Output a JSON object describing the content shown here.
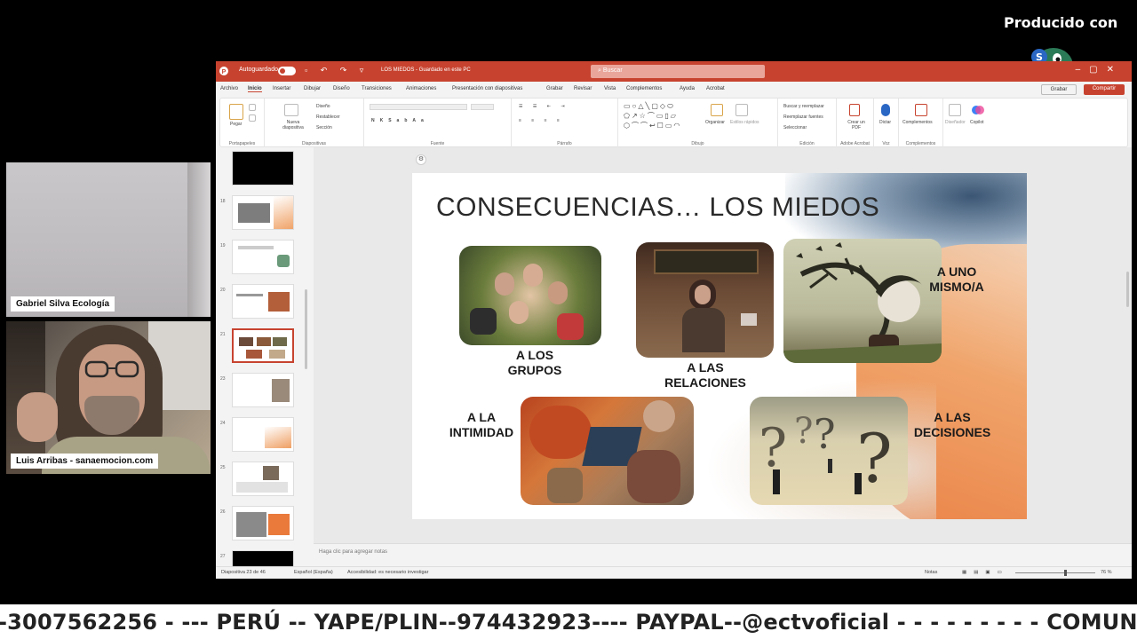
{
  "overlay": {
    "brand_text": "Producido con",
    "ticker": "-3007562256 - --- PERÚ -- YAPE/PLIN--974432923---- PAYPAL--@ectvoficial - - - - - - - - - COMUNÍCATE"
  },
  "participants": [
    {
      "name": "Gabriel Silva Ecología"
    },
    {
      "name": "Luis Arribas - sanaemocion.com"
    }
  ],
  "powerpoint": {
    "titlebar": {
      "autosave_label": "Autoguardado",
      "file_name": "LOS MIEDOS - Guardado en este PC",
      "search_placeholder": "Buscar"
    },
    "tabs": [
      "Archivo",
      "Inicio",
      "Insertar",
      "Dibujar",
      "Diseño",
      "Transiciones",
      "Animaciones",
      "Presentación con diapositivas",
      "Grabar",
      "Revisar",
      "Vista",
      "Complementos",
      "Ayuda",
      "Acrobat"
    ],
    "active_tab": "Inicio",
    "share_label": "Compartir",
    "record_label": "Grabar",
    "ribbon_groups": [
      {
        "label": "Portapapeles",
        "items": [
          "Pegar"
        ]
      },
      {
        "label": "Diapositivas",
        "items": [
          "Nueva diapositiva",
          "Diseño",
          "Restablecer",
          "Sección"
        ]
      },
      {
        "label": "Fuente",
        "items": []
      },
      {
        "label": "Párrafo",
        "items": []
      },
      {
        "label": "Dibujo",
        "items": [
          "Organizar",
          "Estilos rápidos"
        ]
      },
      {
        "label": "Edición",
        "items": [
          "Buscar y reemplazar",
          "Reemplazar fuentes",
          "Seleccionar"
        ]
      },
      {
        "label": "Adobe Acrobat",
        "items": [
          "Crear un PDF"
        ]
      },
      {
        "label": "Voz",
        "items": [
          "Dictar"
        ]
      },
      {
        "label": "Complementos",
        "items": [
          "Complementos"
        ]
      },
      {
        "label": "",
        "items": [
          "Diseñador",
          "Copilot"
        ]
      }
    ],
    "notes_placeholder": "Haga clic para agregar notas",
    "status": {
      "slide_counter": "Diapositiva 23 de 46",
      "language": "Español (España)",
      "accessibility": "Accesibilidad: es necesario investigar",
      "notes": "Notas",
      "zoom": "76 %"
    },
    "slide": {
      "title": "CONSECUENCIAS… LOS MIEDOS",
      "captions": {
        "grupos": "A LOS\nGRUPOS",
        "relaciones": "A LAS\nRELACIONES",
        "uno_mismo": "A UNO\nMISMO/A",
        "intimidad": "A LA\nINTIMIDAD",
        "decisiones": "A LAS\nDECISIONES"
      }
    },
    "thumbnails": [
      {
        "num": "18"
      },
      {
        "num": "19"
      },
      {
        "num": "20"
      },
      {
        "num": "21"
      },
      {
        "num": "23"
      },
      {
        "num": "24"
      },
      {
        "num": "25"
      },
      {
        "num": "26"
      },
      {
        "num": "27"
      },
      {
        "num": "28"
      }
    ]
  },
  "colors": {
    "accent": "#c7432f",
    "slide_orange": "#e97a3c"
  }
}
